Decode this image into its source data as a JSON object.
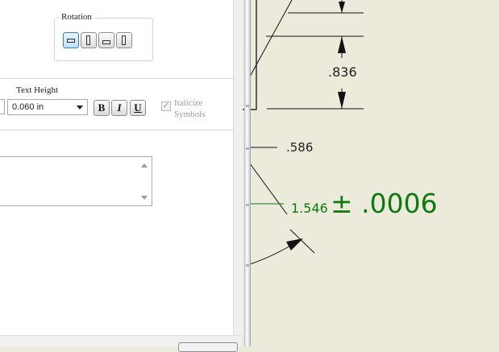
{
  "dialog": {
    "rotation_group": {
      "title": "Rotation",
      "buttons": [
        {
          "name": "horizontal-text",
          "active": true
        },
        {
          "name": "vertical-text-up",
          "active": false
        },
        {
          "name": "horizontal-text-below",
          "active": false
        },
        {
          "name": "vertical-text-down",
          "active": false
        }
      ]
    },
    "text_height": {
      "label": "Text Height",
      "value": "0.060 in"
    },
    "format": {
      "bold": "B",
      "italic": "I",
      "underline": "U"
    },
    "italicize_symbols": {
      "line1": "Italicize",
      "line2": "Symbols",
      "checked": true,
      "enabled": false
    },
    "text_area": {
      "value": ""
    }
  },
  "drawing": {
    "dimension_836": ".836",
    "dimension_586": ".586",
    "tolerance_base": "1.546",
    "tolerance_value": "± .0006",
    "tolerance_color": "#0c7a0c",
    "background_color": "#eceadb"
  }
}
